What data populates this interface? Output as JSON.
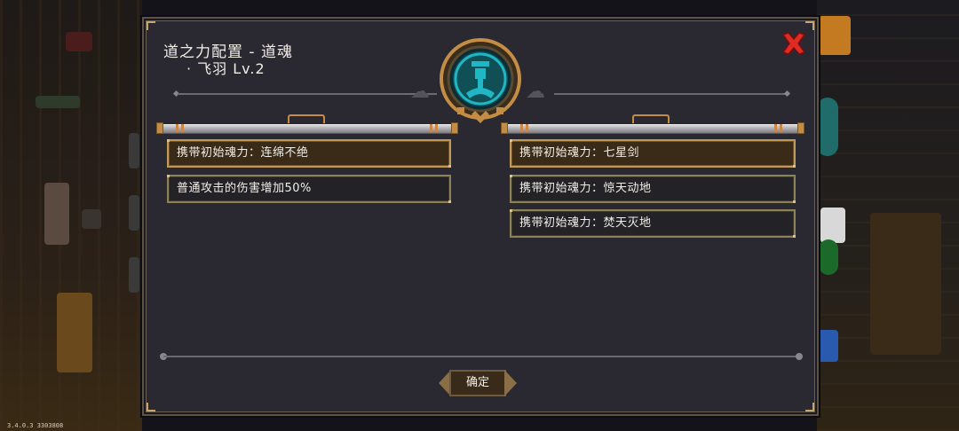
{
  "version": "3.4.0.3 3303808",
  "dialog": {
    "title": "道之力配置 - 道魂",
    "subtitle": "· 飞羽 Lv.2",
    "confirm_label": "确定"
  },
  "left_column": [
    {
      "text": "携带初始魂力：连绵不绝",
      "selected": true
    },
    {
      "text": "普通攻击的伤害增加50%",
      "selected": false
    }
  ],
  "right_column": [
    {
      "text": "携带初始魂力：七星剑",
      "selected": true
    },
    {
      "text": "携带初始魂力：惊天动地",
      "selected": false
    },
    {
      "text": "携带初始魂力：焚天灭地",
      "selected": false
    }
  ],
  "colors": {
    "panel_bg": "#2a2830",
    "accent_gold": "#c39a55",
    "close_red": "#e02b25",
    "emblem_teal": "#1fb7c4"
  },
  "icons": {
    "close": "close-x-icon",
    "emblem": "dao-soul-emblem-icon"
  }
}
